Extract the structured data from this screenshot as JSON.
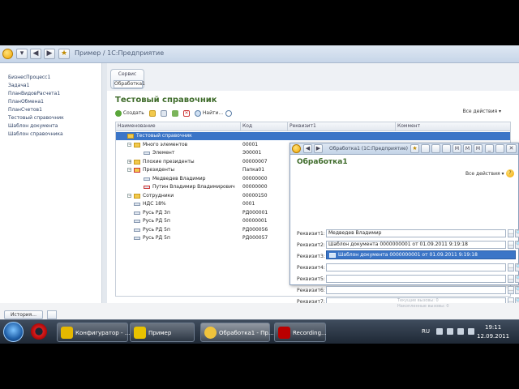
{
  "app": {
    "title": "Пример / 1С:Предприятие"
  },
  "sidebar": {
    "items": [
      {
        "label": "БизнесПроцесс1"
      },
      {
        "label": "Задача1"
      },
      {
        "label": "ПланВидовРасчета1"
      },
      {
        "label": "ПланОбмена1"
      },
      {
        "label": "ПланСчетов1"
      },
      {
        "label": "Тестовый справочник"
      },
      {
        "label": "Шаблон документа"
      },
      {
        "label": "Шаблон справочника"
      }
    ]
  },
  "tabs": {
    "group_label": "Сервис",
    "active_tab": "Обработка1"
  },
  "catalog": {
    "title": "Тестовый справочник",
    "toolbar": {
      "create_label": "Создать",
      "find_label": "Найти...",
      "all_actions_label": "Все действия ▾"
    },
    "columns": [
      "Наименование",
      "Код",
      "Реквизит1",
      "Коммент"
    ],
    "rows": [
      {
        "name": "Тестовый справочник",
        "code": "",
        "selected": true,
        "kind": "folder",
        "level": 0
      },
      {
        "name": "Много элементов",
        "code": "00001",
        "selected": false,
        "kind": "folder",
        "level": 1,
        "expander": "⊖"
      },
      {
        "name": "Элемент",
        "code": "Э00001",
        "selected": false,
        "kind": "element",
        "level": 2
      },
      {
        "name": "Плохие президенты",
        "code": "00000007",
        "selected": false,
        "kind": "folder",
        "level": 1,
        "expander": "⊕"
      },
      {
        "name": "Президенты",
        "code": "Папка01",
        "selected": false,
        "kind": "folder-x",
        "level": 1,
        "expander": "⊖"
      },
      {
        "name": "Медведев Владимир",
        "code": "00000000",
        "selected": false,
        "kind": "element",
        "level": 2
      },
      {
        "name": "Путин Владимир Владимирович",
        "code": "00000000",
        "selected": false,
        "kind": "element-x",
        "level": 2
      },
      {
        "name": "Сотрудники",
        "code": "00000150",
        "selected": false,
        "kind": "folder",
        "level": 1,
        "expander": "⊖"
      },
      {
        "name": "НДС 18%",
        "code": "0001",
        "selected": false,
        "kind": "element",
        "level": 1
      },
      {
        "name": "Русь РД 3п",
        "code": "РД000001",
        "selected": false,
        "kind": "element",
        "level": 1
      },
      {
        "name": "Русь РД 5п",
        "code": "00000001",
        "selected": false,
        "kind": "element",
        "level": 1
      },
      {
        "name": "Русь РД 5п",
        "code": "РД000056",
        "selected": false,
        "kind": "element",
        "level": 1
      },
      {
        "name": "Русь РД 5п",
        "code": "РД000057",
        "selected": false,
        "kind": "element",
        "level": 1
      }
    ]
  },
  "dialog": {
    "window_title": "Обработка1  (1С:Предприятие)",
    "heading": "Обработка1",
    "all_actions_label": "Все действия ▾",
    "help_label": "?",
    "fields": [
      {
        "label": "Реквизит1:",
        "value": "Медведев Владимир"
      },
      {
        "label": "Реквизит2:",
        "value": "Шаблон документа 0000000001 от 01.09.2011 9:19:18"
      },
      {
        "label": "Реквизит3:",
        "value": ""
      },
      {
        "label": "Реквизит4:",
        "value": ""
      },
      {
        "label": "Реквизит5:",
        "value": ""
      },
      {
        "label": "Реквизит6:",
        "value": ""
      },
      {
        "label": "Реквизит7:",
        "value": ""
      }
    ],
    "dropdown_option": "Шаблон документа 0000000001 от 01.09.2011 9:19:18"
  },
  "statusbar": {
    "history_label": "История...",
    "notify_line1": "Текущие вызовы: 0",
    "notify_line2": "Накопленные вызовы: 0"
  },
  "taskbar": {
    "apps": [
      {
        "label": "Конфигуратор - ..."
      },
      {
        "label": "Пример"
      },
      {
        "label": "Обработка1 - Пр..."
      },
      {
        "label": "Recording..."
      }
    ],
    "lang": "RU",
    "time": "19:11",
    "date": "12.09.2011"
  }
}
